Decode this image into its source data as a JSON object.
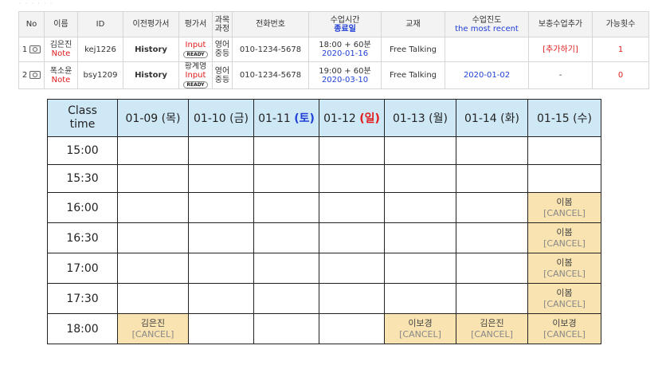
{
  "students": {
    "headers": {
      "no": "No",
      "name": "이름",
      "id": "ID",
      "prev_eval": "이전평가서",
      "eval": "평가서",
      "course_1": "과목",
      "course_2": "과정",
      "phone": "전화번호",
      "class_time": "수업시간",
      "end_date": "종료일",
      "textbook": "교재",
      "progress": "수업진도",
      "progress_sub": "the most recent",
      "makeup": "보충수업추가",
      "available": "가능횟수"
    },
    "rows": [
      {
        "no": "1",
        "name": "김은진",
        "note": "Note",
        "id": "kej1226",
        "prev_eval": "History",
        "eval_writer": "",
        "eval_link": "Input",
        "eval_badge": "READY",
        "course_1": "영어",
        "course_2": "중등",
        "phone": "010-1234-5678",
        "time": "18:00 + 60분",
        "end_date": "2020-01-16",
        "textbook": "Free Talking",
        "progress": "",
        "makeup": "[추가하기]",
        "available": "1"
      },
      {
        "no": "2",
        "name": "폭소윤",
        "note": "Note",
        "id": "bsy1209",
        "prev_eval": "History",
        "eval_writer": "황계영",
        "eval_link": "Input",
        "eval_badge": "READY",
        "course_1": "영어",
        "course_2": "중등",
        "phone": "010-1234-5678",
        "time": "19:00 + 60분",
        "end_date": "2020-03-10",
        "textbook": "Free Talking",
        "progress": "2020-01-02",
        "makeup": "-",
        "available": "0"
      }
    ]
  },
  "schedule": {
    "header_time_1": "Class",
    "header_time_2": "time",
    "days": [
      {
        "date": "01-09",
        "dow": "(목)"
      },
      {
        "date": "01-10",
        "dow": "(금)"
      },
      {
        "date": "01-11",
        "dow": "(토)"
      },
      {
        "date": "01-12",
        "dow": "(일)"
      },
      {
        "date": "01-13",
        "dow": "(월)"
      },
      {
        "date": "01-14",
        "dow": "(화)"
      },
      {
        "date": "01-15",
        "dow": "(수)"
      }
    ],
    "times": [
      "15:00",
      "15:30",
      "16:00",
      "16:30",
      "17:00",
      "17:30",
      "18:00"
    ],
    "bookings": {
      "b1600": {
        "name": "이봄",
        "cancel": "[CANCEL]"
      },
      "b1630": {
        "name": "이봄",
        "cancel": "[CANCEL]"
      },
      "b1700": {
        "name": "이봄",
        "cancel": "[CANCEL]"
      },
      "b1730": {
        "name": "이봄",
        "cancel": "[CANCEL]"
      },
      "b1800_0109": {
        "name": "김은진",
        "cancel": "[CANCEL]"
      },
      "b1800_0113": {
        "name": "이보경",
        "cancel": "[CANCEL]"
      },
      "b1800_0114": {
        "name": "김은진",
        "cancel": "[CANCEL]"
      },
      "b1800_0115": {
        "name": "이보경",
        "cancel": "[CANCEL]"
      }
    }
  },
  "colors": {
    "header_bg": "#cfe8f6",
    "booking_bg": "#f9e3b0",
    "saturday": "#1f3fd6",
    "sunday": "#e21a1a"
  }
}
